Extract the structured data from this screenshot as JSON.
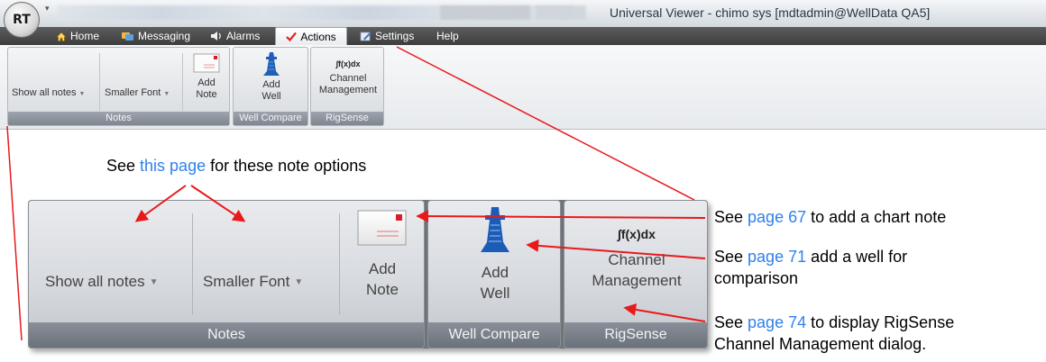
{
  "window": {
    "logo_text": "RT",
    "title": "Universal Viewer - chimo sys [mdtadmin@WellData QA5]"
  },
  "menu": {
    "tabs": [
      {
        "label": "Home",
        "icon": "home-icon"
      },
      {
        "label": "Messaging",
        "icon": "messaging-icon"
      },
      {
        "label": "Alarms",
        "icon": "alarm-speaker-icon"
      },
      {
        "label": "Actions",
        "icon": "checkmark-icon",
        "active": true
      },
      {
        "label": "Settings",
        "icon": "settings-icon"
      },
      {
        "label": "Help",
        "icon": ""
      }
    ]
  },
  "ribbon": {
    "notes": {
      "show_all_notes": "Show all notes",
      "smaller_font": "Smaller Font",
      "add_note_line1": "Add",
      "add_note_line2": "Note",
      "label": "Notes"
    },
    "well_compare": {
      "add_well_line1": "Add",
      "add_well_line2": "Well",
      "label": "Well Compare"
    },
    "rigsense": {
      "formula": "∫f(x)dx",
      "channel_line1": "Channel",
      "channel_line2": "Management",
      "label": "RigSense"
    }
  },
  "annotations": {
    "top_prefix": "See ",
    "top_link": "this page",
    "top_suffix": " for these note options",
    "note_prefix": "See ",
    "note_link": "page 67",
    "note_suffix": " to add a chart note",
    "well_prefix": "See ",
    "well_link": "page 71",
    "well_suffix": " add a well for",
    "well_line2": "comparison",
    "rig_prefix": "See ",
    "rig_link": "page 74",
    "rig_suffix": " to display RigSense",
    "rig_line2": "Channel Management dialog."
  },
  "colors": {
    "arrow": "#e8191b",
    "link": "#2f80ed",
    "menubar": "#4a4a4a"
  }
}
